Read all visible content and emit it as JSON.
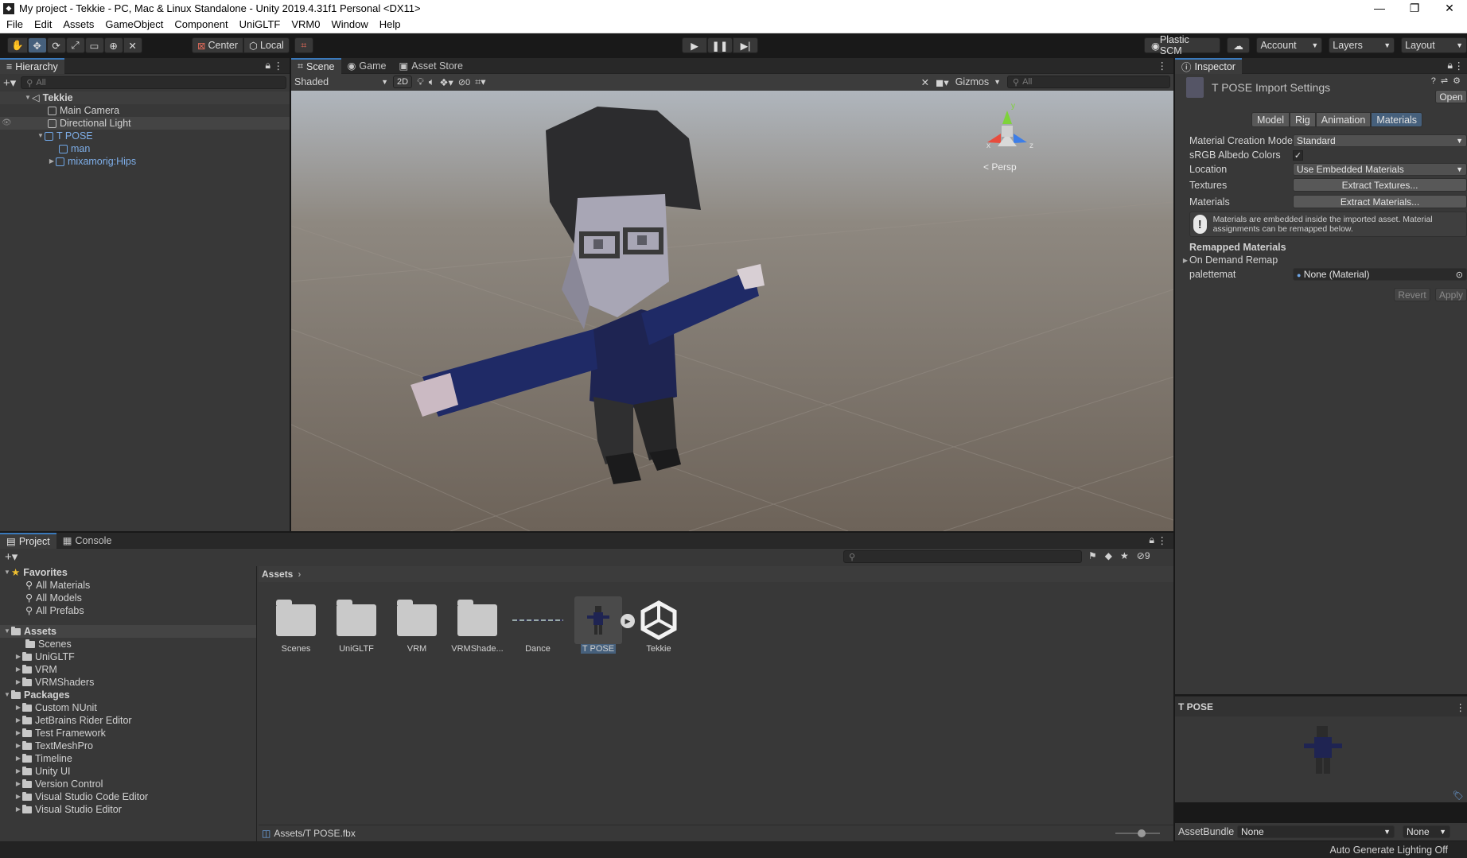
{
  "window": {
    "title": "My project - Tekkie - PC, Mac & Linux Standalone - Unity 2019.4.31f1 Personal <DX11>",
    "controls": [
      "—",
      "❐",
      "✕"
    ]
  },
  "menu": [
    "File",
    "Edit",
    "Assets",
    "GameObject",
    "Component",
    "UniGLTF",
    "VRM0",
    "Window",
    "Help"
  ],
  "toolbar": {
    "pivot": "Center",
    "space": "Local",
    "plastic": "Plastic SCM",
    "account": "Account",
    "layers": "Layers",
    "layout": "Layout"
  },
  "hierarchy": {
    "tab": "Hierarchy",
    "search_placeholder": "All",
    "scene": "Tekkie",
    "items": [
      {
        "label": "Main Camera"
      },
      {
        "label": "Directional Light"
      },
      {
        "label": "T POSE"
      },
      {
        "label": "man"
      },
      {
        "label": "mixamorig:Hips"
      }
    ]
  },
  "scene_view": {
    "tabs": [
      "Scene",
      "Game",
      "Asset Store"
    ],
    "shading": "Shaded",
    "mode2d": "2D",
    "hidden_count": "0",
    "gizmos": "Gizmos",
    "search_placeholder": "All",
    "persp": "< Persp",
    "axes": {
      "x": "x",
      "y": "y",
      "z": "z"
    }
  },
  "inspector": {
    "tab": "Inspector",
    "title": "T POSE Import Settings",
    "open_button": "Open",
    "tabs": [
      "Model",
      "Rig",
      "Animation",
      "Materials"
    ],
    "fields": {
      "material_creation_mode_label": "Material Creation Mode",
      "material_creation_mode_value": "Standard",
      "srgb_label": "sRGB Albedo Colors",
      "location_label": "Location",
      "location_value": "Use Embedded Materials",
      "textures_label": "Textures",
      "textures_button": "Extract Textures...",
      "materials_label": "Materials",
      "materials_button": "Extract Materials..."
    },
    "info_message": "Materials are embedded inside the imported asset. Material assignments can be remapped below.",
    "remapped_header": "Remapped Materials",
    "on_demand": "On Demand Remap",
    "palette_label": "palettemat",
    "palette_value": "None (Material)",
    "revert": "Revert",
    "apply": "Apply",
    "preview_title": "T POSE",
    "assetbundle_label": "AssetBundle",
    "assetbundle_value": "None",
    "assetbundle_variant": "None"
  },
  "project": {
    "tabs": [
      "Project",
      "Console"
    ],
    "favorites_header": "Favorites",
    "favorites": [
      "All Materials",
      "All Models",
      "All Prefabs"
    ],
    "assets_header": "Assets",
    "asset_folders": [
      "Scenes",
      "UniGLTF",
      "VRM",
      "VRMShaders"
    ],
    "packages_header": "Packages",
    "packages": [
      "Custom NUnit",
      "JetBrains Rider Editor",
      "Test Framework",
      "TextMeshPro",
      "Timeline",
      "Unity UI",
      "Version Control",
      "Visual Studio Code Editor",
      "Visual Studio Editor"
    ],
    "breadcrumb": "Assets",
    "hidden_count": "9",
    "grid_items": [
      {
        "label": "Scenes"
      },
      {
        "label": "UniGLTF"
      },
      {
        "label": "VRM"
      },
      {
        "label": "VRMShade..."
      },
      {
        "label": "Dance"
      },
      {
        "label": "T POSE"
      },
      {
        "label": "Tekkie"
      }
    ],
    "status_path": "Assets/T POSE.fbx"
  },
  "statusbar": {
    "right": "Auto Generate Lighting Off"
  }
}
